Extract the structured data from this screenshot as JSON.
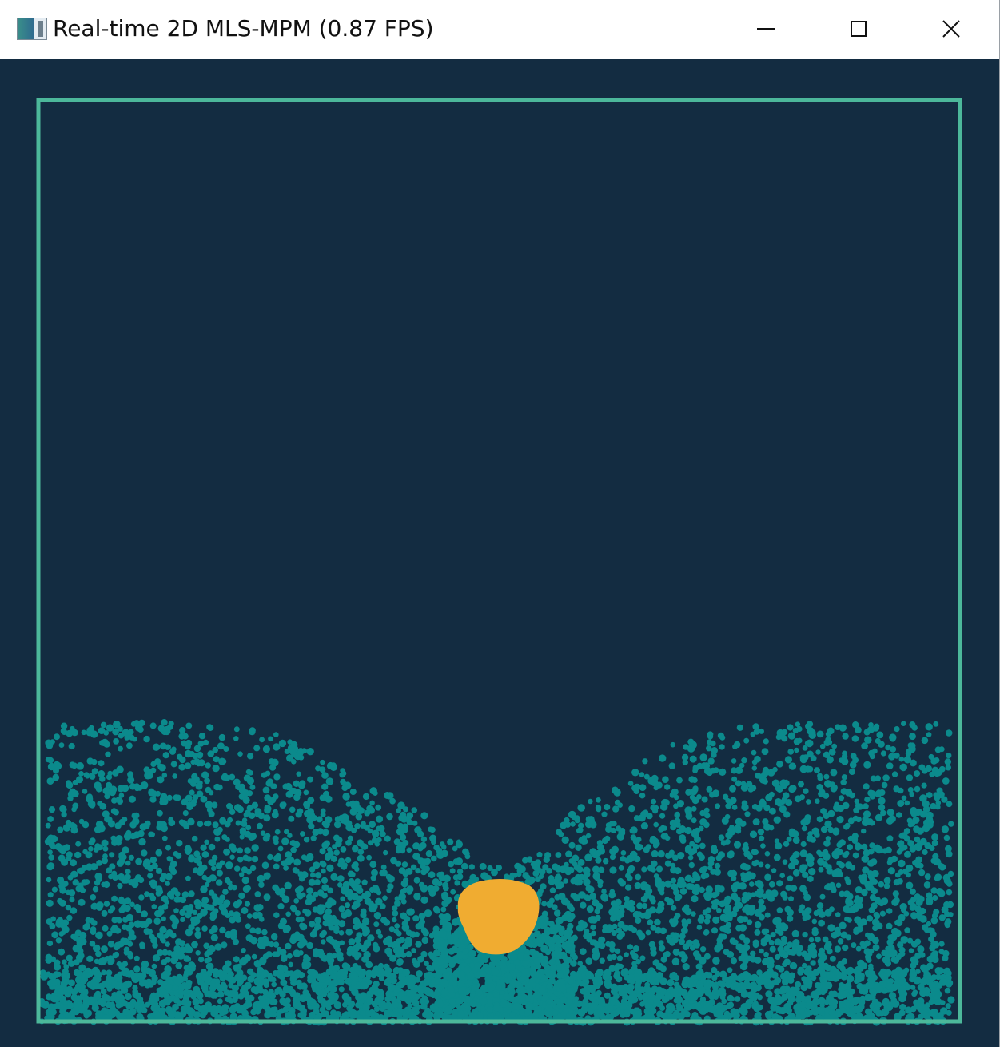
{
  "window": {
    "title": "Real-time 2D MLS-MPM (0.87 FPS)",
    "app_icon": "app-window-icon",
    "controls": {
      "minimize_icon": "minimize-icon",
      "maximize_icon": "maximize-icon",
      "close_icon": "close-icon"
    }
  },
  "simulation": {
    "background_color": "#132c41",
    "boundary_color": "#4cb89a",
    "fluid_color": "#0b8a8c",
    "solid_color": "#f0ac31",
    "materials": [
      "fluid-particles",
      "solid-blob"
    ]
  }
}
